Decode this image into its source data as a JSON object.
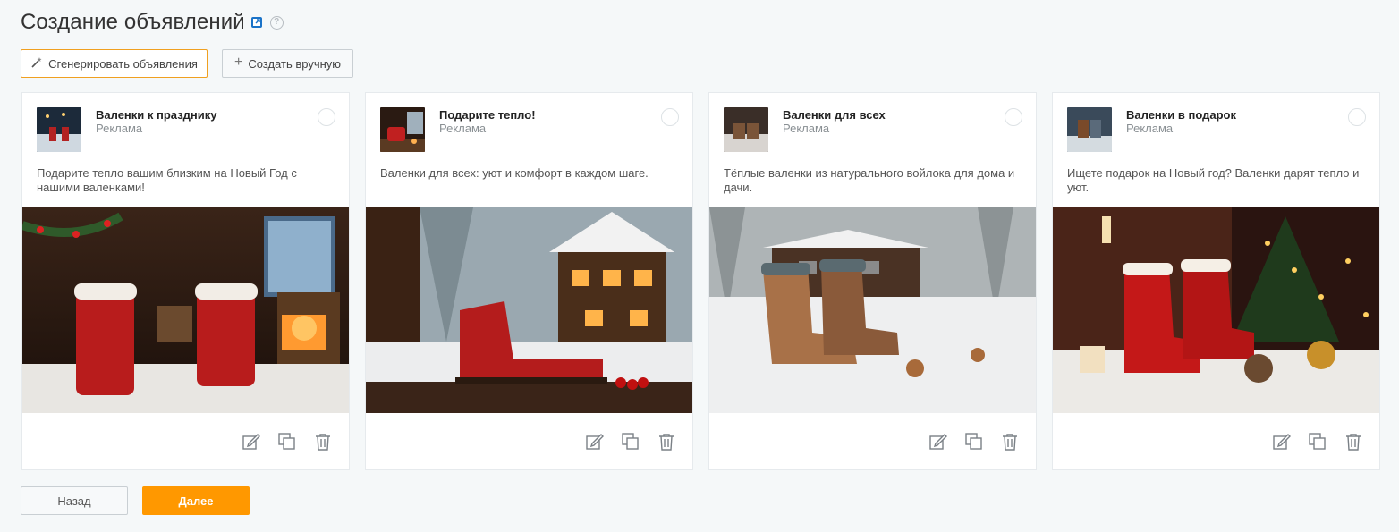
{
  "page": {
    "title": "Создание объявлений",
    "external_icon": "external-link-icon",
    "help_icon": "help-icon"
  },
  "toolbar": {
    "generate_label": "Сгенерировать объявления",
    "generate_icon": "magic-wand-icon",
    "manual_label": "Создать вручную",
    "manual_icon": "plus-icon"
  },
  "cards": [
    {
      "title": "Валенки к празднику",
      "subtitle": "Реклама",
      "text": "Подарите тепло вашим близким на Новый Год с нашими валенками!"
    },
    {
      "title": "Подарите тепло!",
      "subtitle": "Реклама",
      "text": "Валенки для всех: уют и комфорт в каждом шаге."
    },
    {
      "title": "Валенки для всех",
      "subtitle": "Реклама",
      "text": "Тёплые валенки из натурального войлока для дома и дачи."
    },
    {
      "title": "Валенки в подарок",
      "subtitle": "Реклама",
      "text": "Ищете подарок на Новый год? Валенки дарят тепло и уют."
    }
  ],
  "card_actions": [
    "edit-icon",
    "copy-icon",
    "trash-icon"
  ],
  "footer": {
    "back_label": "Назад",
    "next_label": "Далее"
  },
  "colors": {
    "accent": "#ff9800",
    "generate_border": "#f0a020",
    "background": "#f5f8f9"
  }
}
